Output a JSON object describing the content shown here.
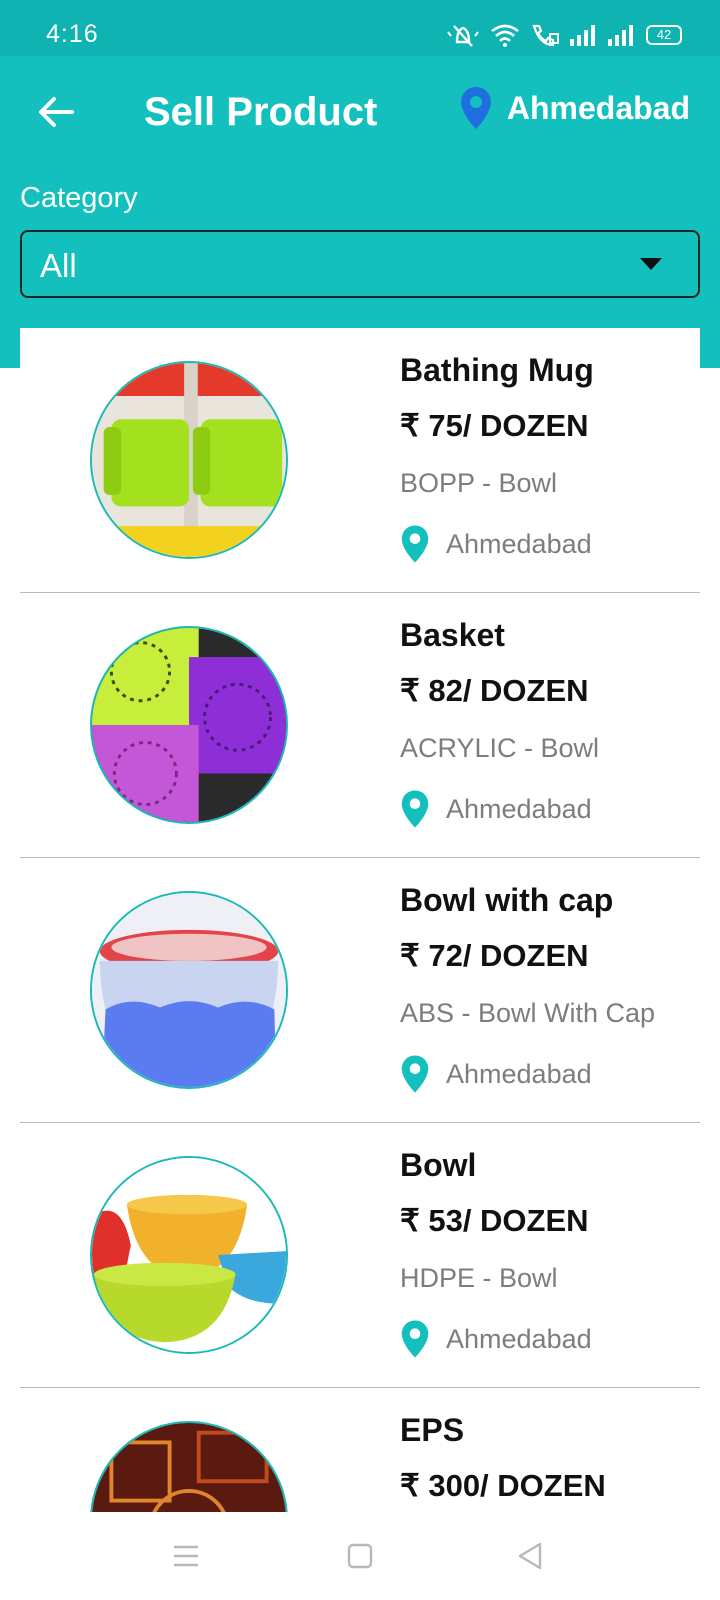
{
  "status_bar": {
    "time": "4:16",
    "battery": "42",
    "icons": [
      "mute-icon",
      "wifi-icon",
      "wifi-call-icon",
      "signal-icon",
      "signal-icon",
      "battery-icon"
    ]
  },
  "header": {
    "title": "Sell Product",
    "location": "Ahmedabad",
    "back_icon": "arrow-left-icon",
    "location_icon": "location-pin-icon"
  },
  "filter": {
    "label": "Category",
    "selected": "All"
  },
  "products": [
    {
      "name": "Bathing Mug",
      "price": "₹ 75/ DOZEN",
      "category": "BOPP - Bowl",
      "location": "Ahmedabad"
    },
    {
      "name": "Basket",
      "price": "₹ 82/ DOZEN",
      "category": "ACRYLIC - Bowl",
      "location": "Ahmedabad"
    },
    {
      "name": "Bowl with cap",
      "price": "₹ 72/ DOZEN",
      "category": "ABS - Bowl With Cap",
      "location": "Ahmedabad"
    },
    {
      "name": "Bowl",
      "price": "₹ 53/ DOZEN",
      "category": "HDPE - Bowl",
      "location": "Ahmedabad"
    },
    {
      "name": "EPS",
      "price": "₹ 300/ DOZEN",
      "category": "",
      "location": ""
    }
  ],
  "colors": {
    "primary": "#14c0bd",
    "status_bar": "#0fb3b1",
    "location_pin_header": "#1f6fe0",
    "location_pin_item": "#14c0bd",
    "text_dark": "#111111",
    "text_muted": "#7d7d7d"
  },
  "nav": {
    "icons": [
      "menu-icon",
      "home-icon",
      "back-triangle-icon"
    ]
  }
}
